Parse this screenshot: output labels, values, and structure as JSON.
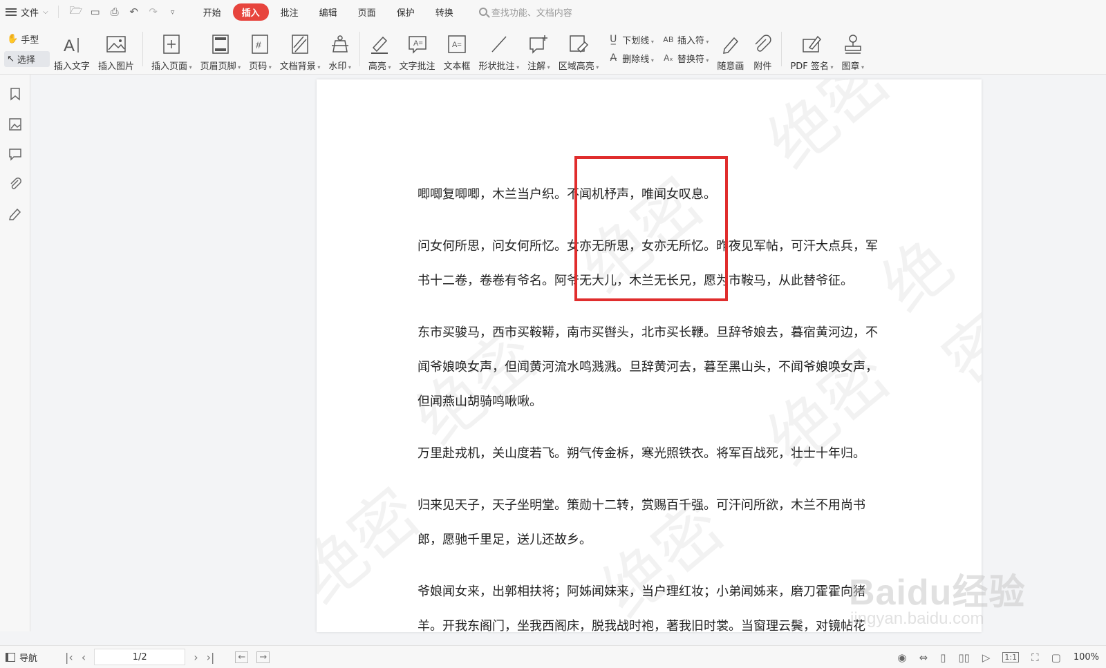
{
  "menubar": {
    "file_label": "文件",
    "tabs": [
      "开始",
      "插入",
      "批注",
      "编辑",
      "页面",
      "保护",
      "转换"
    ],
    "active_tab": "插入",
    "search_placeholder": "查找功能、文档内容"
  },
  "ribbon": {
    "hand_label": "手型",
    "select_label": "选择",
    "buttons": {
      "insert_text": "插入文字",
      "insert_image": "插入图片",
      "insert_page": "插入页面",
      "header_footer": "页眉页脚",
      "page_number": "页码",
      "doc_background": "文档背景",
      "watermark": "水印",
      "highlight": "高亮",
      "text_comment": "文字批注",
      "text_box": "文本框",
      "shape_comment": "形状批注",
      "note": "注解",
      "area_highlight": "区域高亮",
      "underline": "下划线",
      "strikethrough": "删除线",
      "insert_mark": "插入符",
      "replace_mark": "替换符",
      "freehand": "随意画",
      "attachment": "附件",
      "pdf_sign": "PDF 签名",
      "stamp": "图章"
    }
  },
  "document": {
    "paragraphs": [
      "唧唧复唧唧，木兰当户织。不闻机杼声，唯闻女叹息。",
      "问女何所思，问女何所忆。女亦无所思，女亦无所忆。昨夜见军帖，可汗大点兵，军书十二卷，卷卷有爷名。阿爷无大儿，木兰无长兄，愿为市鞍马，从此替爷征。",
      "东市买骏马，西市买鞍鞯，南市买辔头，北市买长鞭。旦辞爷娘去，暮宿黄河边，不闻爷娘唤女声，但闻黄河流水鸣溅溅。旦辞黄河去，暮至黑山头，不闻爷娘唤女声，但闻燕山胡骑鸣啾啾。",
      "万里赴戎机，关山度若飞。朔气传金柝，寒光照铁衣。将军百战死，壮士十年归。",
      "归来见天子，天子坐明堂。策勋十二转，赏赐百千强。可汗问所欲，木兰不用尚书郎，愿驰千里足，送儿还故乡。",
      "爷娘闻女来，出郭相扶将；阿姊闻妹来，当户理红妆；小弟闻姊来，磨刀霍霍向猪羊。开我东阁门，坐我西阁床，脱我战时袍，著我旧时裳。当窗理云鬓，对镜帖花黄。出门"
    ],
    "watermark_text": "绝密"
  },
  "overlay": {
    "baidu_logo": "Baidu经验",
    "baidu_url": "jingyan.baidu.com"
  },
  "statusbar": {
    "nav_label": "导航",
    "page_indicator": "1/2",
    "zoom": "100%"
  },
  "colors": {
    "accent": "#e7443d",
    "highlight_box": "#e02d2d"
  }
}
